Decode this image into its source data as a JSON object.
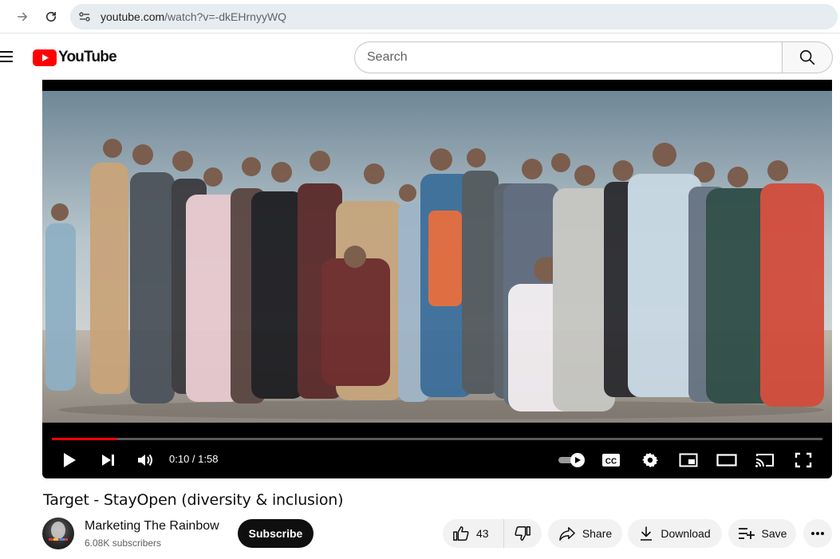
{
  "browser": {
    "url_host": "youtube.com",
    "url_path": "/watch?v=-dkEHrnyyWQ",
    "icons": [
      "forward-arrow-icon",
      "reload-icon",
      "site-info-icon"
    ]
  },
  "header": {
    "logo_text": "YouTube",
    "search_placeholder": "Search",
    "brand_color": "#ff0000"
  },
  "player": {
    "current_time": "0:10",
    "duration": "1:58",
    "time_display": "0:10 / 1:58",
    "progress_fraction": 0.085,
    "autoplay": "on",
    "cc_label": "CC",
    "icons": [
      "play-icon",
      "next-icon",
      "volume-icon",
      "autoplay-toggle-icon",
      "captions-icon",
      "settings-icon",
      "miniplayer-icon",
      "theater-mode-icon",
      "cast-icon",
      "fullscreen-icon"
    ]
  },
  "video": {
    "title": "Target - StayOpen (diversity & inclusion)"
  },
  "channel": {
    "name": "Marketing The Rainbow",
    "subscribers": "6.08K subscribers",
    "subscribe_label": "Subscribe"
  },
  "actions": {
    "likes": "43",
    "share_label": "Share",
    "download_label": "Download",
    "save_label": "Save"
  }
}
